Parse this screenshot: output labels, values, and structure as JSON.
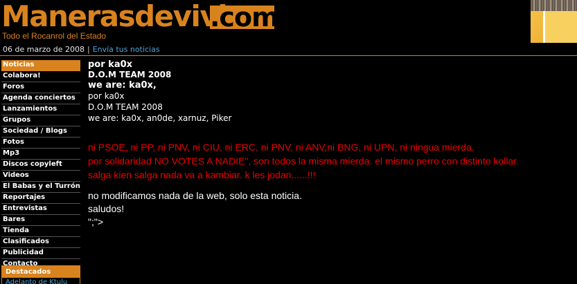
{
  "header": {
    "logo_main": "Manerasdevivir",
    "logo_dotcom": ".com",
    "tagline": "Todo el Rocanrol del Estado",
    "date": "06 de marzo de 2008",
    "separator": "|",
    "send_news_link": "Envía tus noticias"
  },
  "sidebar": {
    "items": [
      {
        "label": "Noticias",
        "active": true
      },
      {
        "label": "Colabora!"
      },
      {
        "label": "Foros"
      },
      {
        "label": "Agenda conciertos"
      },
      {
        "label": "Lanzamientos"
      },
      {
        "label": "Grupos"
      },
      {
        "label": "Sociedad / Blogs"
      },
      {
        "label": "Fotos"
      },
      {
        "label": "Mp3"
      },
      {
        "label": "Discos copyleft"
      },
      {
        "label": "Videos"
      },
      {
        "label": "El Babas y el Turrón"
      },
      {
        "label": "Reportajes"
      },
      {
        "label": "Entrevistas"
      },
      {
        "label": "Bares"
      },
      {
        "label": "Tienda"
      },
      {
        "label": "Clasificados"
      },
      {
        "label": "Publicidad"
      },
      {
        "label": "Contacto"
      }
    ],
    "destacados": {
      "title": "Destacados",
      "first_link": "Adelanto de Ktulu"
    }
  },
  "main": {
    "heading1": "por ka0x",
    "heading2": "D.O.M TEAM 2008",
    "heading3": "we are: ka0x,",
    "plain1": "por ka0x",
    "plain2": "D.O.M TEAM 2008",
    "plain3": "we are: ka0x, an0de, xarnuz, Piker",
    "red_lines": [
      "ni PSOE, ni PP, ni PNV, ni CIU, ni ERC, ni PNV, ni ANV,ni BNG, ni UPN, ni ningua mierda.",
      "por solidaridad NO VOTES A NADIE\", son todos la misma mierda. el mismo perro con distinto kollar.",
      "salga kien salga nada va a kambiar. k les jodan......!!!"
    ],
    "white_lines": [
      "no modificamos nada de la web, solo esta noticia.",
      "saludos!",
      "\";\">"
    ]
  },
  "colors": {
    "accent": "#d9831e",
    "background": "#000000",
    "link": "#4fa3d9",
    "alert_text": "#ee0000"
  }
}
